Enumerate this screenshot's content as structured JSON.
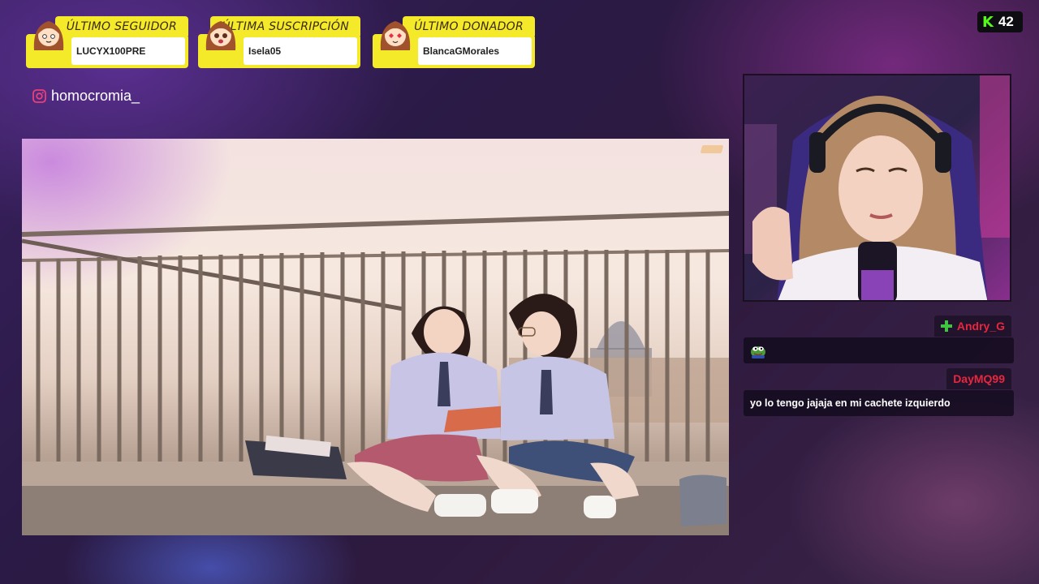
{
  "alerts": [
    {
      "title": "ÚLTIMO SEGUIDOR",
      "name": "LUCYX100PRE"
    },
    {
      "title": "ÚLTIMA SUSCRIPCIÓN",
      "name": "Isela05"
    },
    {
      "title": "ÚLTIMO DONADOR",
      "name": "BlancaGMorales"
    }
  ],
  "social": {
    "instagram": "homocromia_"
  },
  "viewer_count": {
    "letter": "K",
    "count": "42"
  },
  "chat": [
    {
      "user": "Andry_G",
      "message": "",
      "has_emote": true,
      "user_color": "#e8273f"
    },
    {
      "user": "DayMQ99",
      "message": "yo lo tengo jajaja en mi cachete izquierdo",
      "has_emote": false,
      "user_color": "#e8273f"
    }
  ],
  "colors": {
    "alert_accent": "#f4ea2a",
    "kick_green": "#53fc18",
    "chat_username": "#e8273f"
  }
}
